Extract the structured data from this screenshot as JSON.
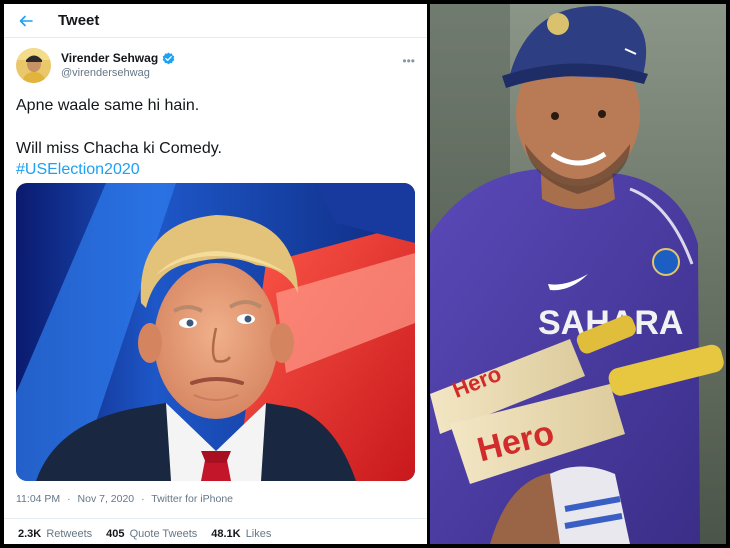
{
  "header": {
    "title": "Tweet",
    "back_icon": "arrow-left-icon"
  },
  "author": {
    "name": "Virender Sehwag",
    "handle": "@virendersehwag",
    "verified_icon": "verified-badge-icon",
    "more_icon": "more-horizontal-icon",
    "more_label": "•••"
  },
  "tweet": {
    "line1": "Apne waale same hi hain.",
    "line2": "Will miss Chacha ki Comedy.",
    "hashtag": "#USElection2020"
  },
  "meta": {
    "time": "11:04 PM",
    "date": "Nov 7, 2020",
    "source": "Twitter for iPhone",
    "separator": "·"
  },
  "stats": [
    {
      "count": "2.3K",
      "label": "Retweets"
    },
    {
      "count": "405",
      "label": "Quote Tweets"
    },
    {
      "count": "48.1K",
      "label": "Likes"
    }
  ],
  "photo": {
    "jersey_text": "SAHARA",
    "bat_text": "Hero",
    "bat_text_2": "Hero"
  },
  "colors": {
    "link": "#1da1f2",
    "text": "#14171a",
    "muted": "#657786",
    "jersey": "#4a3c9e"
  }
}
